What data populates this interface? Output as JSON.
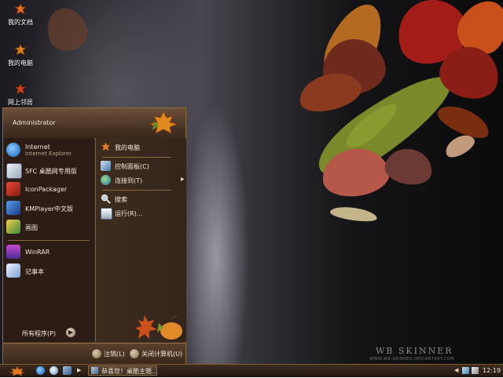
{
  "desktop": {
    "icons": [
      {
        "label": "我的文档",
        "icon": "folder-leaf-icon"
      },
      {
        "label": "我的电脑",
        "icon": "computer-leaf-icon"
      },
      {
        "label": "网上邻居",
        "icon": "network-leaf-icon"
      }
    ],
    "watermark_title": "WB SKINNER",
    "watermark_url": "WWW.WB-SKINNER.DEVIANTART.COM"
  },
  "start_menu": {
    "user_name": "Administrator",
    "left_items": [
      {
        "title": "Internet",
        "subtitle": "Internet Explorer",
        "icon": "internet-explorer-icon"
      },
      {
        "title": "SFC 桌酷网专用版",
        "icon": "sfc-app-icon"
      },
      {
        "title": "IconPackager",
        "icon": "iconpackager-icon"
      },
      {
        "title": "KMPlayer中文版",
        "icon": "kmplayer-icon"
      },
      {
        "title": "画图",
        "icon": "paint-icon"
      },
      {
        "title": "WinRAR",
        "icon": "winrar-icon"
      },
      {
        "title": "记事本",
        "icon": "notepad-icon"
      }
    ],
    "all_programs": "所有程序(P)",
    "right_items": [
      {
        "title": "我的电脑",
        "icon": "my-computer-leaf-icon"
      },
      {
        "title": "控制面板(C)",
        "icon": "control-panel-icon"
      },
      {
        "title": "连接到(T)",
        "icon": "connect-to-icon"
      },
      {
        "title": "搜索",
        "icon": "search-icon"
      },
      {
        "title": "运行(R)...",
        "icon": "run-icon"
      }
    ],
    "logoff": "注销(L)",
    "shutdown": "关闭计算机(U)"
  },
  "taskbar": {
    "task_label": "恭喜您！桌酷主题...",
    "clock": "12:19"
  },
  "colors": {
    "menu_bg": "#2b1d15",
    "menu_border": "#8a6a3e",
    "taskbar_bg": "#221710"
  }
}
